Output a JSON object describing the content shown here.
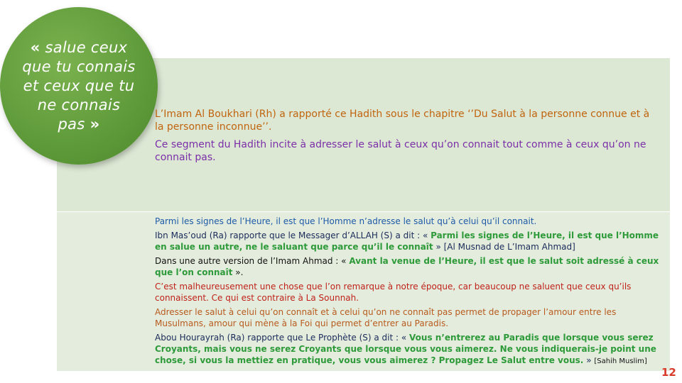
{
  "circle": {
    "quote_open": "«",
    "text": " salue ceux que tu connais et ceux que tu ne connais pas ",
    "quote_close": "»"
  },
  "intro": {
    "p1": "L’Imam Al Boukhari (Rh) a rapporté ce Hadith sous le chapitre ‘’Du Salut à la personne connue et à la personne inconnue’’.",
    "p2": "Ce segment du Hadith incite à adresser le salut à ceux qu’on connait tout comme à ceux qu’on ne connait pas."
  },
  "body": {
    "p1": "Parmi les signes de l’Heure, il est que l’Homme n’adresse le salut qu’à celui qu’il connait.",
    "p2_pre": "Ibn Mas’oud (Ra) rapporte que le Messager d’ALLAH (S) a dit : « ",
    "p2_quote": "Parmi les signes de l’Heure, il est que l’Homme en salue un autre, ne le saluant que parce qu’il le connaît",
    "p2_post": " » [Al Musnad de L’Imam Ahmad]",
    "p3_pre": "Dans une autre version de l’Imam Ahmad : « ",
    "p3_quote": "Avant la venue de l’Heure, il est que le salut soit adressé à ceux que l’on connaît",
    "p3_post": " ».",
    "p4": "C’est malheureusement une chose que l’on remarque à notre époque, car beaucoup ne saluent que ceux qu’ils connaissent. Ce qui est contraire à La Sounnah.",
    "p5": "Adresser le salut à celui qu’on connaît et à celui qu’on ne connaît pas permet de propager l’amour entre les Musulmans, amour qui mène à la Foi qui permet d’entrer au Paradis.",
    "p6_pre": "Abou Hourayrah (Ra) rapporte que Le Prophète (S) a dit : « ",
    "p6_quote": "Vous n’entrerez au Paradis que lorsque vous serez Croyants, mais vous ne serez Croyants que lorsque vous vous aimerez. Ne vous indiquerais-je point une chose, si vous la mettiez en pratique, vous vous aimerez ? Propagez Le Salut entre vous.",
    "p6_post": " » ",
    "p6_source": "[Sahih Muslim]"
  },
  "page_number": "12",
  "colors": {
    "panel_top": "#dde8d4",
    "panel_bottom": "#e4eddd",
    "circle_green": "#5f9a3a",
    "quote_green": "#2e9a3a",
    "page_number": "#d83a2a"
  }
}
